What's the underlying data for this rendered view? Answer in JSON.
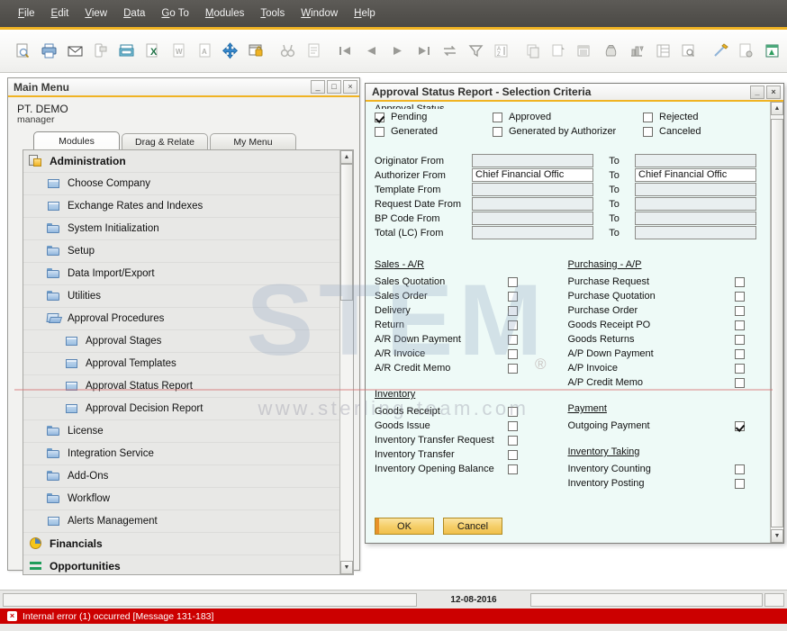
{
  "menubar": {
    "items": [
      {
        "label": "File",
        "accel": "F"
      },
      {
        "label": "Edit",
        "accel": "E"
      },
      {
        "label": "View",
        "accel": "V"
      },
      {
        "label": "Data",
        "accel": "D"
      },
      {
        "label": "Go To",
        "accel": "G"
      },
      {
        "label": "Modules",
        "accel": "M"
      },
      {
        "label": "Tools",
        "accel": "T"
      },
      {
        "label": "Window",
        "accel": "W"
      },
      {
        "label": "Help",
        "accel": "H"
      }
    ]
  },
  "toolbar": {
    "buttons": [
      {
        "icon": "print-preview-icon",
        "title": "Print Preview"
      },
      {
        "icon": "print-icon",
        "title": "Print"
      },
      {
        "icon": "email-icon",
        "title": "Send Email"
      },
      {
        "icon": "sms-icon",
        "title": "Send SMS"
      },
      {
        "icon": "fax-icon",
        "title": "Send Fax"
      },
      {
        "icon": "export-excel-icon",
        "title": "Export to MS Excel"
      },
      {
        "icon": "export-word-icon",
        "title": "Export to MS Word"
      },
      {
        "icon": "export-pdf-icon",
        "title": "Export to PDF"
      },
      {
        "icon": "launch-application-icon",
        "title": "Launch Application"
      },
      {
        "icon": "lock-screen-icon",
        "title": "Lock Screen"
      },
      {
        "icon": "find-icon",
        "title": "Find"
      },
      {
        "icon": "add-icon",
        "title": "Add"
      },
      {
        "icon": "first-record-icon",
        "title": "First Data Record"
      },
      {
        "icon": "previous-record-icon",
        "title": "Previous Record"
      },
      {
        "icon": "next-record-icon",
        "title": "Next Record"
      },
      {
        "icon": "last-record-icon",
        "title": "Last Data Record"
      },
      {
        "icon": "refresh-icon",
        "title": "Refresh"
      },
      {
        "icon": "filter-icon",
        "title": "Filter Table"
      },
      {
        "icon": "sort-icon",
        "title": "Sort Table"
      },
      {
        "icon": "copy-icon",
        "title": "Copy"
      },
      {
        "icon": "paste-icon",
        "title": "Paste"
      },
      {
        "icon": "journal-entry-icon",
        "title": "Journal Entry"
      },
      {
        "icon": "money-bag-icon",
        "title": "Incoming Payments"
      },
      {
        "icon": "balance-scale-icon",
        "title": "Trial Balance"
      },
      {
        "icon": "general-ledger-icon",
        "title": "General Ledger"
      },
      {
        "icon": "document-journal-icon",
        "title": "Document Journal"
      },
      {
        "icon": "edit-note-icon",
        "title": "Edit"
      },
      {
        "icon": "form-settings-icon",
        "title": "Form Settings"
      },
      {
        "icon": "user-defined-windows-icon",
        "title": "User-Defined Windows"
      }
    ]
  },
  "main_menu": {
    "title": "Main Menu",
    "window_buttons": {
      "minimize": "_",
      "maximize": "□",
      "close": "×"
    },
    "company": "PT. DEMO",
    "user": "manager",
    "tabs": [
      {
        "label": "Modules",
        "accel": "M",
        "active": true
      },
      {
        "label": "Drag & Relate",
        "accel": "a",
        "active": false
      },
      {
        "label": "My Menu",
        "accel": "y",
        "active": false
      }
    ],
    "tree": [
      {
        "label": "Administration",
        "icon": "administration-module-icon",
        "level": 0,
        "bold": true
      },
      {
        "label": "Choose Company",
        "icon": "leaf-icon",
        "level": 1,
        "bold": false
      },
      {
        "label": "Exchange Rates and Indexes",
        "icon": "leaf-icon",
        "level": 1,
        "bold": false
      },
      {
        "label": "System Initialization",
        "icon": "folder-icon",
        "level": 1,
        "bold": false
      },
      {
        "label": "Setup",
        "icon": "folder-icon",
        "level": 1,
        "bold": false
      },
      {
        "label": "Data Import/Export",
        "icon": "folder-icon",
        "level": 1,
        "bold": false
      },
      {
        "label": "Utilities",
        "icon": "folder-icon",
        "level": 1,
        "bold": false
      },
      {
        "label": "Approval Procedures",
        "icon": "folder-open-icon",
        "level": 1,
        "bold": false
      },
      {
        "label": "Approval Stages",
        "icon": "leaf-icon",
        "level": 2,
        "bold": false
      },
      {
        "label": "Approval Templates",
        "icon": "leaf-icon",
        "level": 2,
        "bold": false
      },
      {
        "label": "Approval Status Report",
        "icon": "leaf-icon",
        "level": 2,
        "bold": false
      },
      {
        "label": "Approval Decision Report",
        "icon": "leaf-icon",
        "level": 2,
        "bold": false
      },
      {
        "label": "License",
        "icon": "folder-icon",
        "level": 1,
        "bold": false
      },
      {
        "label": "Integration Service",
        "icon": "folder-icon",
        "level": 1,
        "bold": false
      },
      {
        "label": "Add-Ons",
        "icon": "folder-icon",
        "level": 1,
        "bold": false
      },
      {
        "label": "Workflow",
        "icon": "folder-icon",
        "level": 1,
        "bold": false
      },
      {
        "label": "Alerts Management",
        "icon": "leaf-icon",
        "level": 1,
        "bold": false
      },
      {
        "label": "Financials",
        "icon": "financials-module-icon",
        "level": 0,
        "bold": true
      },
      {
        "label": "Opportunities",
        "icon": "opportunities-module-icon",
        "level": 0,
        "bold": true
      }
    ]
  },
  "dialog": {
    "title": "Approval Status Report - Selection Criteria",
    "window_buttons": {
      "minimize": "_",
      "close": "×"
    },
    "clipped_group_title": "Approval Status",
    "status_options": [
      {
        "label": "Pending",
        "accel": "P",
        "checked": true
      },
      {
        "label": "Generated",
        "accel": "r",
        "checked": false
      },
      {
        "label": "Approved",
        "accel": "A",
        "checked": false
      },
      {
        "label": "Generated by Authorizer",
        "accel": "e",
        "checked": false
      },
      {
        "label": "Rejected",
        "accel": "R",
        "checked": false
      },
      {
        "label": "Canceled",
        "accel": "C",
        "checked": false
      }
    ],
    "to_label": "To",
    "fields": [
      {
        "label": "Originator From",
        "from_value": "",
        "to_value": "",
        "filled": false
      },
      {
        "label": "Authorizer From",
        "from_value": "Chief Financial Offic",
        "to_value": "Chief Financial Offic",
        "filled": true
      },
      {
        "label": "Template From",
        "from_value": "",
        "to_value": "",
        "filled": false
      },
      {
        "label": "Request Date From",
        "from_value": "",
        "to_value": "",
        "filled": false
      },
      {
        "label": "BP Code From",
        "from_value": "",
        "to_value": "",
        "filled": false
      },
      {
        "label": "Total (LC) From",
        "from_value": "",
        "to_value": "",
        "filled": false
      }
    ],
    "doc_sections_left": [
      {
        "title": "Sales - A/R",
        "items": [
          {
            "label": "Sales Quotation",
            "checked": false
          },
          {
            "label": "Sales Order",
            "checked": false
          },
          {
            "label": "Delivery",
            "checked": false
          },
          {
            "label": "Return",
            "checked": false
          },
          {
            "label": "A/R Down Payment",
            "checked": false
          },
          {
            "label": "A/R Invoice",
            "checked": false
          },
          {
            "label": "A/R Credit Memo",
            "checked": false
          }
        ]
      },
      {
        "title": "Inventory",
        "items": [
          {
            "label": "Goods Receipt",
            "checked": false
          },
          {
            "label": "Goods Issue",
            "checked": false
          },
          {
            "label": "Inventory Transfer Request",
            "checked": false
          },
          {
            "label": "Inventory Transfer",
            "checked": false
          },
          {
            "label": "Inventory Opening Balance",
            "checked": false
          }
        ]
      }
    ],
    "doc_sections_right": [
      {
        "title": "Purchasing - A/P",
        "items": [
          {
            "label": "Purchase Request",
            "checked": false
          },
          {
            "label": "Purchase Quotation",
            "checked": false
          },
          {
            "label": "Purchase Order",
            "checked": false
          },
          {
            "label": "Goods Receipt PO",
            "checked": false
          },
          {
            "label": "Goods Returns",
            "checked": false
          },
          {
            "label": "A/P Down Payment",
            "checked": false
          },
          {
            "label": "A/P Invoice",
            "checked": false
          },
          {
            "label": "A/P Credit Memo",
            "checked": false
          }
        ]
      },
      {
        "title": "Payment",
        "items": [
          {
            "label": "Outgoing Payment",
            "checked": true
          }
        ]
      },
      {
        "title": "Inventory Taking",
        "items": [
          {
            "label": "Inventory Counting",
            "checked": false
          },
          {
            "label": "Inventory Posting",
            "checked": false
          }
        ]
      }
    ],
    "buttons": {
      "ok": "OK",
      "cancel": "Cancel"
    }
  },
  "statusbar": {
    "left_text": "",
    "date": "12-08-2016",
    "mid_text": "",
    "error": {
      "icon": "error-icon",
      "glyph": "×",
      "message": "Internal error (1) occurred  [Message 131-183]"
    }
  },
  "watermark": {
    "brand": "STEM",
    "registered": "®",
    "url": "www.sterling-team.com"
  },
  "colors": {
    "menubar_bg": "#54524e",
    "accent": "#f0b323",
    "dialog_bg": "#eefaf7",
    "error_bg": "#cc0000",
    "button_gold": "#f5cf6b"
  }
}
